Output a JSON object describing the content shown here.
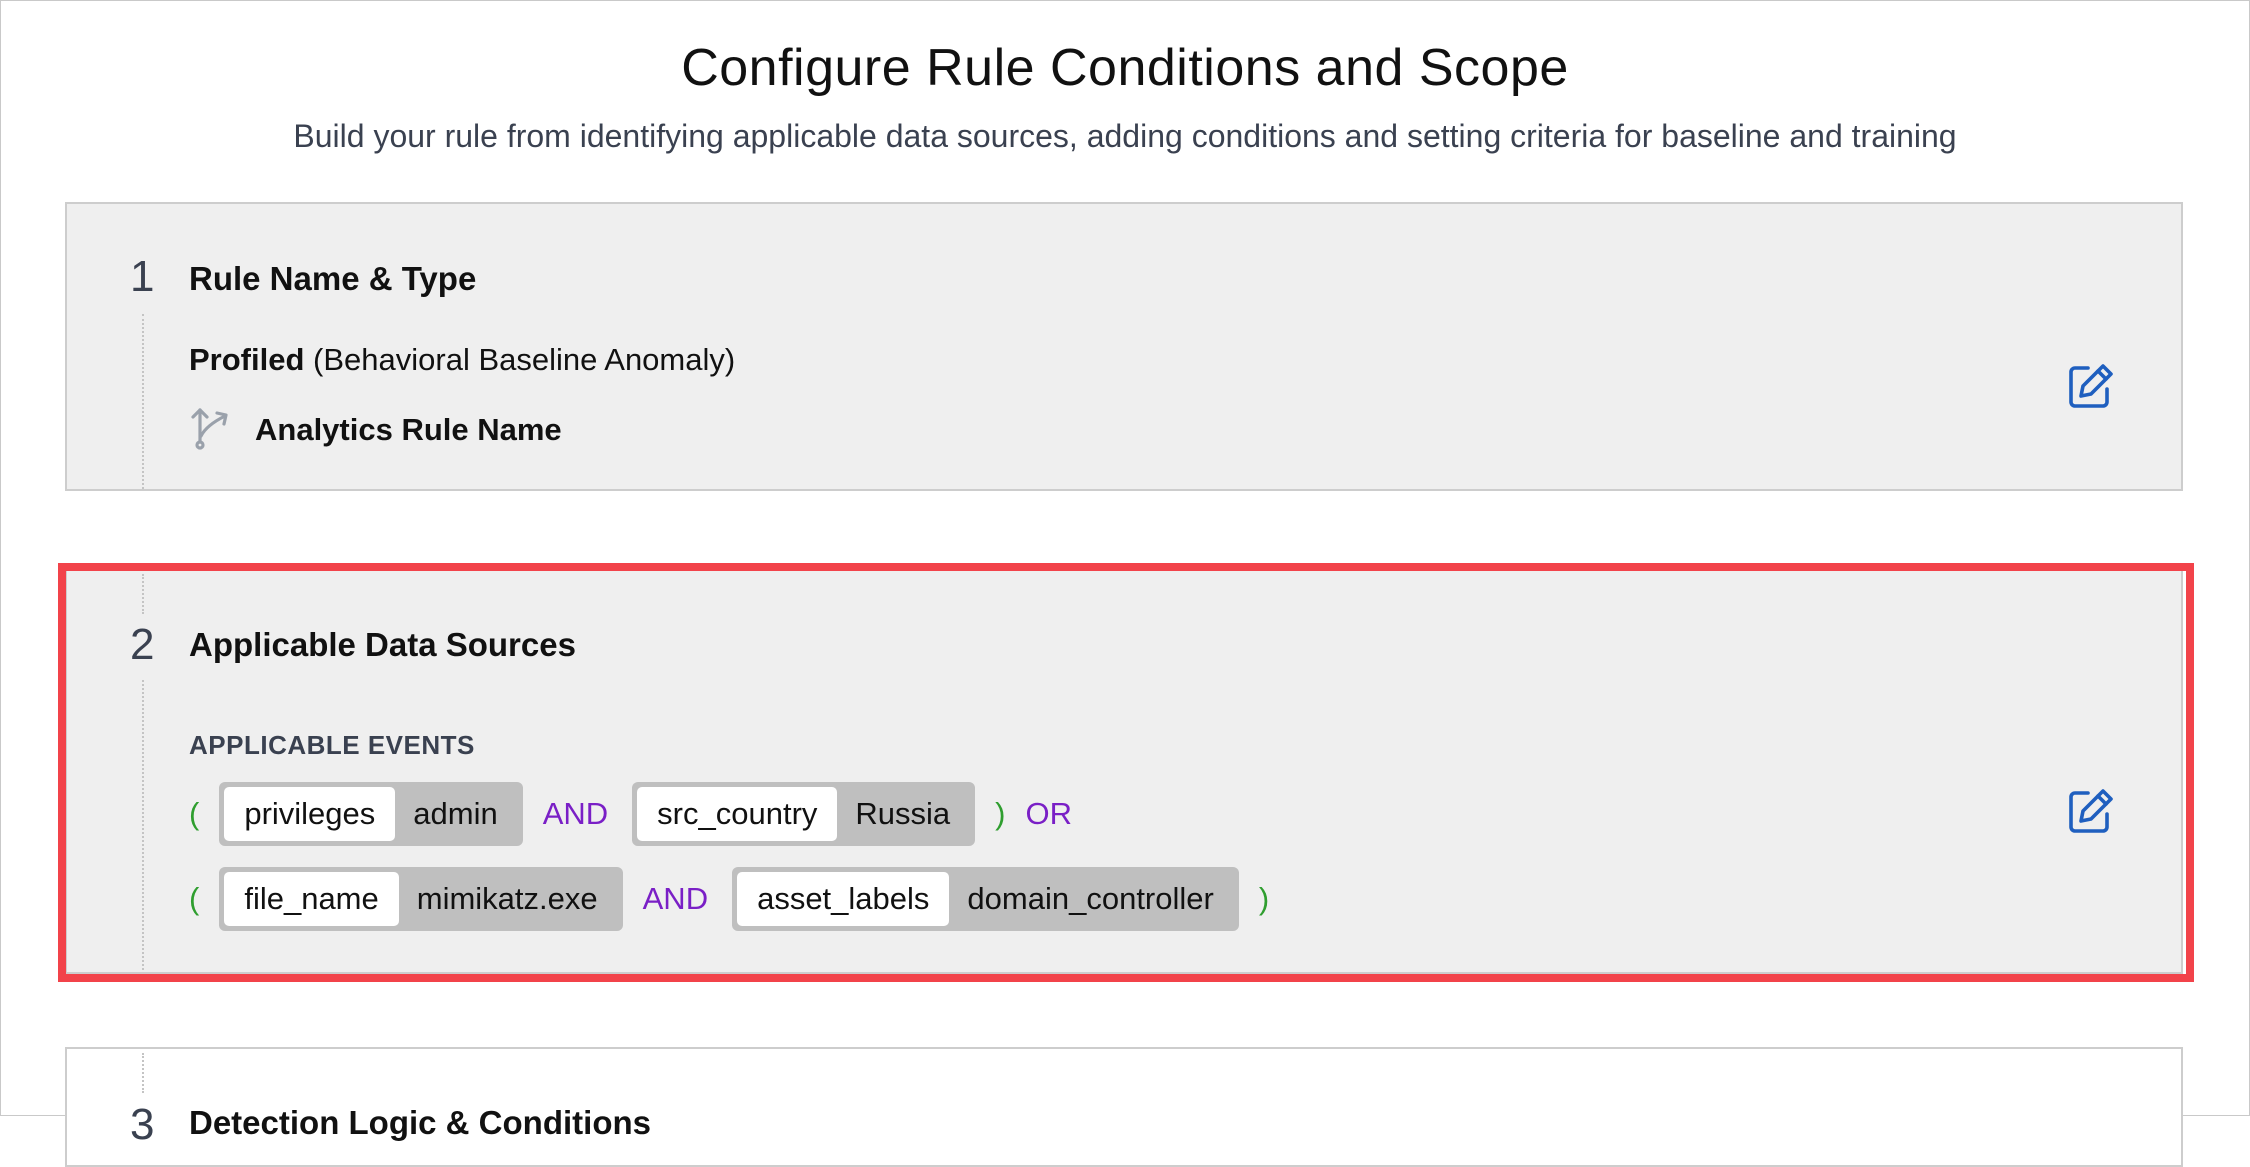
{
  "page": {
    "title": "Configure Rule Conditions and Scope",
    "subtitle": "Build your rule from identifying applicable data sources, adding conditions and setting criteria for baseline and training"
  },
  "steps": [
    {
      "number": "1",
      "title": "Rule Name & Type",
      "type_label": "Profiled",
      "type_description": "(Behavioral Baseline Anomaly)",
      "rule_name": "Analytics Rule Name",
      "rule_icon": "merge-arrows-icon",
      "edit_icon": "edit-icon"
    },
    {
      "number": "2",
      "title": "Applicable Data Sources",
      "section_label": "APPLICABLE EVENTS",
      "edit_icon": "edit-icon",
      "conditions": [
        {
          "open": "(",
          "terms": [
            {
              "key": "privileges",
              "value": "admin"
            },
            {
              "op": "AND"
            },
            {
              "key": "src_country",
              "value": "Russia"
            }
          ],
          "close": ")",
          "join": "OR"
        },
        {
          "open": "(",
          "terms": [
            {
              "key": "file_name",
              "value": "mimikatz.exe"
            },
            {
              "op": "AND"
            },
            {
              "key": "asset_labels",
              "value": "domain_controller"
            }
          ],
          "close": ")"
        }
      ]
    },
    {
      "number": "3",
      "title": "Detection Logic & Conditions"
    }
  ],
  "colors": {
    "highlight": "#f2434a",
    "paren": "#2f9e2f",
    "operator": "#7a1fc6",
    "edit_icon": "#1f5fbf"
  }
}
